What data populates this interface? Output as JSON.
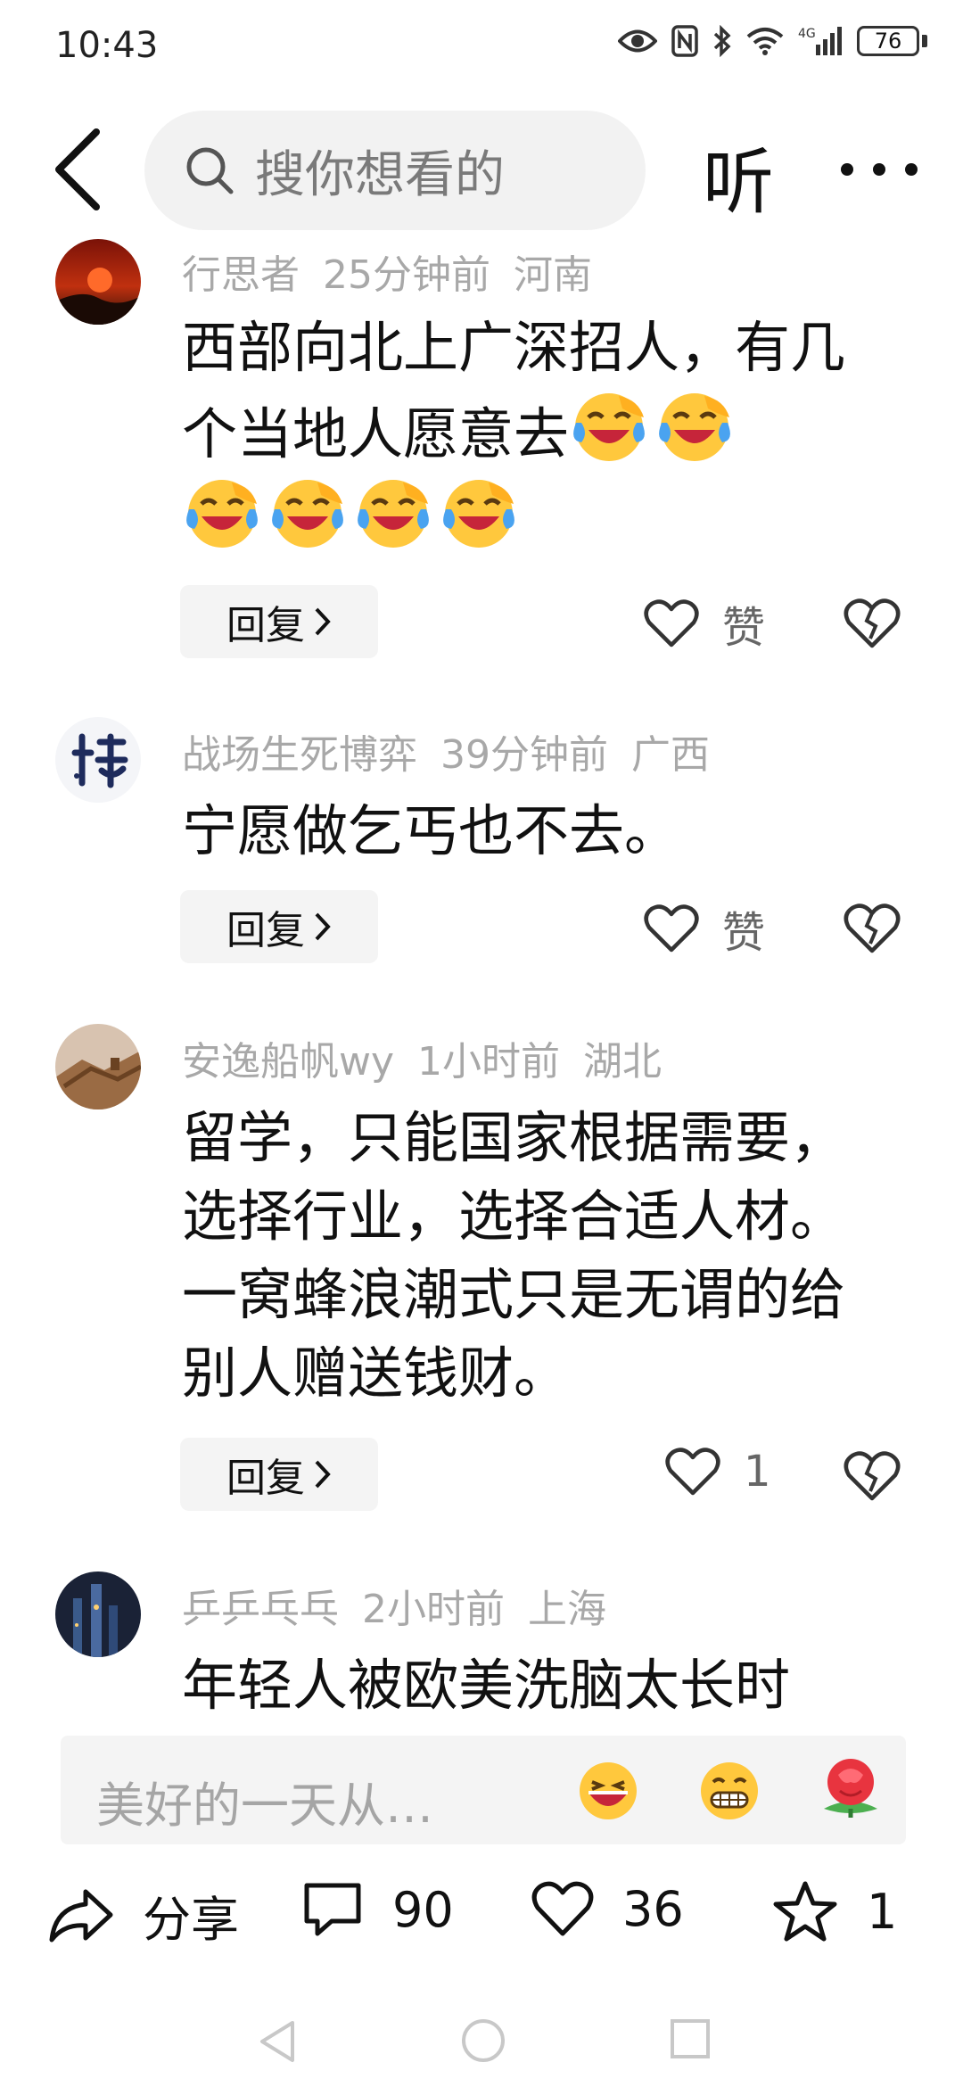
{
  "status_bar": {
    "time": "10:43",
    "battery": "76",
    "network": "4G"
  },
  "search": {
    "placeholder": "搜你想看的"
  },
  "header": {
    "listen_label": "听"
  },
  "comments": [
    {
      "user": "行思者",
      "time": "25分钟前",
      "location": "河南",
      "text": "西部向北上广深招人，有几个当地人愿意去",
      "reply_label": "回复",
      "like_label": "赞",
      "emojis": [
        "laugh-cry",
        "laugh-cry",
        "laugh-cry",
        "laugh-cry",
        "laugh-cry",
        "laugh-cry"
      ]
    },
    {
      "user": "战场生死博弈",
      "time": "39分钟前",
      "location": "广西",
      "text": "宁愿做乞丐也不去。",
      "reply_label": "回复",
      "like_label": "赞"
    },
    {
      "user": "安逸船帆wy",
      "time": "1小时前",
      "location": "湖北",
      "text": "留学，只能国家根据需要，选择行业，选择合适人材。一窝蜂浪潮式只是无谓的给别人赠送钱财。",
      "reply_label": "回复",
      "like_label": "1"
    },
    {
      "user": "乒乒乓乓",
      "time": "2小时前",
      "location": "上海",
      "text": "年轻人被欧美洗脑太长时"
    }
  ],
  "input": {
    "placeholder": "美好的一天从…"
  },
  "actions": {
    "share_label": "分享",
    "comments_count": "90",
    "likes_count": "36",
    "favorites_count": "1"
  },
  "colors": {
    "meta": "#a8a8a8",
    "accent": "#111111"
  }
}
